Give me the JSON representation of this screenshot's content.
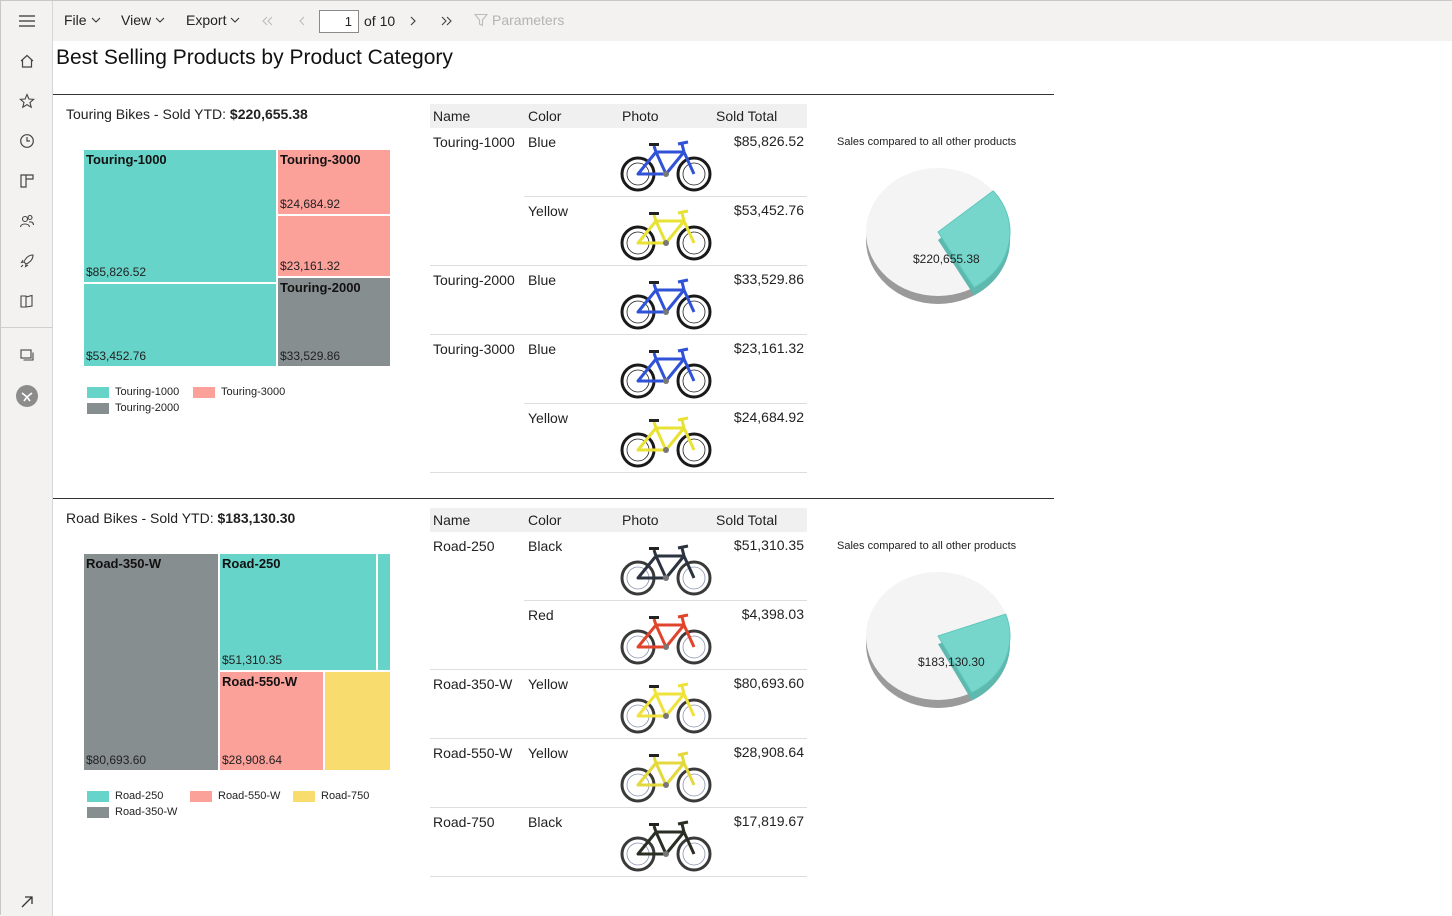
{
  "toolbar": {
    "file": "File",
    "view": "View",
    "export": "Export",
    "page_current": "1",
    "page_of": "of 10",
    "parameters": "Parameters"
  },
  "report": {
    "title": "Best Selling Products by Product Category",
    "sections": [
      {
        "label": "Touring Bikes - Sold YTD: ",
        "total": "$220,655.38",
        "pie_title": "Sales compared to all other products",
        "pie_value": "$220,655.38",
        "treemap": [
          {
            "name": "Touring-1000",
            "value": "$85,826.52"
          },
          {
            "name": "",
            "value": "$53,452.76"
          },
          {
            "name": "Touring-3000",
            "value": "$24,684.92"
          },
          {
            "name": "",
            "value": "$23,161.32"
          },
          {
            "name": "Touring-2000",
            "value": "$33,529.86"
          }
        ],
        "legend": [
          "Touring-1000",
          "Touring-3000",
          "Touring-2000"
        ],
        "table_head": {
          "name": "Name",
          "color": "Color",
          "photo": "Photo",
          "total": "Sold Total"
        },
        "rows": [
          {
            "name": "Touring-1000",
            "color": "Blue",
            "total": "$85,826.52"
          },
          {
            "name": "",
            "color": "Yellow",
            "total": "$53,452.76"
          },
          {
            "name": "Touring-2000",
            "color": "Blue",
            "total": "$33,529.86"
          },
          {
            "name": "Touring-3000",
            "color": "Blue",
            "total": "$23,161.32"
          },
          {
            "name": "",
            "color": "Yellow",
            "total": "$24,684.92"
          }
        ]
      },
      {
        "label": "Road Bikes - Sold YTD: ",
        "total": "$183,130.30",
        "pie_title": "Sales compared to all other products",
        "pie_value": "$183,130.30",
        "treemap": [
          {
            "name": "Road-350-W",
            "value": "$80,693.60"
          },
          {
            "name": "Road-250",
            "value": "$51,310.35"
          },
          {
            "name": "Road-550-W",
            "value": "$28,908.64"
          },
          {
            "name": "",
            "value": ""
          },
          {
            "name": "",
            "value": ""
          }
        ],
        "legend": [
          "Road-250",
          "Road-550-W",
          "Road-750",
          "Road-350-W"
        ],
        "table_head": {
          "name": "Name",
          "color": "Color",
          "photo": "Photo",
          "total": "Sold Total"
        },
        "rows": [
          {
            "name": "Road-250",
            "color": "Black",
            "total": "$51,310.35"
          },
          {
            "name": "",
            "color": "Red",
            "total": "$4,398.03"
          },
          {
            "name": "Road-350-W",
            "color": "Yellow",
            "total": "$80,693.60"
          },
          {
            "name": "Road-550-W",
            "color": "Yellow",
            "total": "$28,908.64"
          },
          {
            "name": "Road-750",
            "color": "Black",
            "total": "$17,819.67"
          }
        ]
      }
    ]
  },
  "colors": {
    "teal": "#66d4c9",
    "salmon": "#fca09a",
    "gray": "#878e8f",
    "yellow": "#f8dc6e",
    "pie_slice": "#77d6cc",
    "pie_bg": "#f4f4f4"
  },
  "icons": {
    "rail": [
      "hamburger-icon",
      "home-icon",
      "star-icon",
      "clock-icon",
      "apps-icon",
      "people-icon",
      "rocket-icon",
      "workspaces-icon",
      "screen-icon",
      "avatar-icon",
      "expand-arrow-icon"
    ],
    "toolbar": [
      "chevron-down-icon",
      "first-page-icon",
      "previous-page-icon",
      "next-page-icon",
      "last-page-icon",
      "filter-icon"
    ]
  }
}
